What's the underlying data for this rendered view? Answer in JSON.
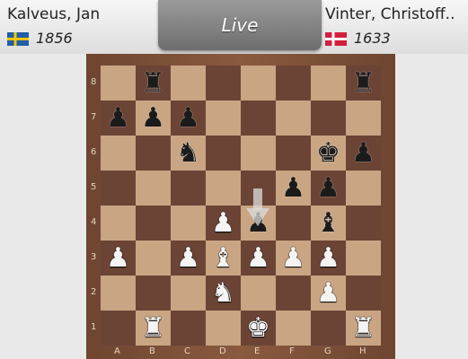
{
  "players": {
    "white": {
      "name": "Kalveus, Jan",
      "rating": "1856",
      "flag": "sweden-flag-icon"
    },
    "black": {
      "name": "Vinter, Christoff..",
      "rating": "1633",
      "flag": "denmark-flag-icon"
    }
  },
  "live_button": {
    "label": "Live"
  },
  "board": {
    "files": [
      "A",
      "B",
      "C",
      "D",
      "E",
      "F",
      "G",
      "H"
    ],
    "ranks": [
      "8",
      "7",
      "6",
      "5",
      "4",
      "3",
      "2",
      "1"
    ],
    "colors": {
      "light": "#c9a583",
      "dark": "#6b4436"
    },
    "pieces": [
      {
        "square": "b8",
        "piece": "rook",
        "color": "black"
      },
      {
        "square": "h8",
        "piece": "rook",
        "color": "black"
      },
      {
        "square": "a7",
        "piece": "pawn",
        "color": "black"
      },
      {
        "square": "b7",
        "piece": "pawn",
        "color": "black"
      },
      {
        "square": "c7",
        "piece": "pawn",
        "color": "black"
      },
      {
        "square": "c6",
        "piece": "knight",
        "color": "black"
      },
      {
        "square": "g6",
        "piece": "king",
        "color": "black"
      },
      {
        "square": "h6",
        "piece": "pawn",
        "color": "black"
      },
      {
        "square": "f5",
        "piece": "pawn",
        "color": "black"
      },
      {
        "square": "g5",
        "piece": "pawn",
        "color": "black"
      },
      {
        "square": "d4",
        "piece": "pawn",
        "color": "white"
      },
      {
        "square": "e4",
        "piece": "pawn",
        "color": "black"
      },
      {
        "square": "g4",
        "piece": "bishop",
        "color": "black"
      },
      {
        "square": "a3",
        "piece": "pawn",
        "color": "white"
      },
      {
        "square": "c3",
        "piece": "pawn",
        "color": "white"
      },
      {
        "square": "d3",
        "piece": "bishop",
        "color": "white"
      },
      {
        "square": "e3",
        "piece": "pawn",
        "color": "white"
      },
      {
        "square": "f3",
        "piece": "pawn",
        "color": "white"
      },
      {
        "square": "g3",
        "piece": "pawn",
        "color": "white"
      },
      {
        "square": "d2",
        "piece": "knight",
        "color": "white"
      },
      {
        "square": "g2",
        "piece": "pawn",
        "color": "white"
      },
      {
        "square": "b1",
        "piece": "rook",
        "color": "white"
      },
      {
        "square": "e1",
        "piece": "king",
        "color": "white"
      },
      {
        "square": "h1",
        "piece": "rook",
        "color": "white"
      }
    ],
    "last_move": {
      "from": "e5",
      "to": "e4"
    }
  }
}
